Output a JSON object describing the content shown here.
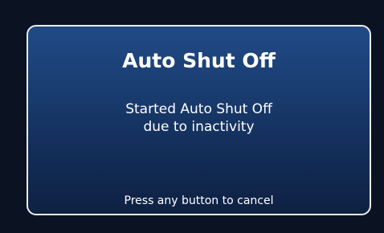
{
  "dialog": {
    "title": "Auto Shut Off",
    "message_line1": "Started Auto Shut Off",
    "message_line2": "due to inactivity",
    "hint": "Press any button to cancel"
  },
  "colors": {
    "background": "#0b1222",
    "dialog_gradient_top": "#214a86",
    "dialog_gradient_bottom": "#0e2142",
    "border": "#e9eef6",
    "text": "#ffffff"
  }
}
